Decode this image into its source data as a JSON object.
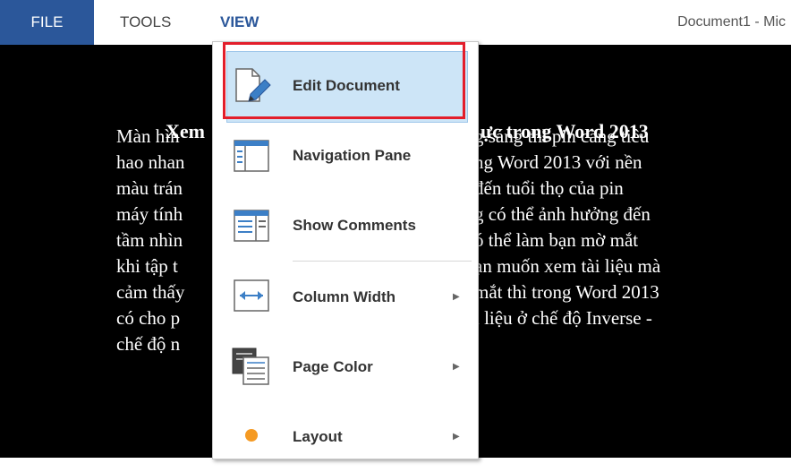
{
  "ribbon": {
    "tabs": [
      {
        "label": "FILE"
      },
      {
        "label": "TOOLS"
      },
      {
        "label": "VIEW"
      }
    ],
    "window_title": "Document1 - Mic"
  },
  "document": {
    "heading_left": "Xem",
    "heading_right": "ực trong Word 2013",
    "lines": [
      {
        "left": "Màn hìn",
        "right": "g sáng thì pin càng tiêu"
      },
      {
        "left": "hao nhan",
        "right": "ng Word 2013 với nền"
      },
      {
        "left": "màu trán",
        "right": "đến tuổi thọ của pin"
      },
      {
        "left": "máy tính",
        "right": "g có thể ảnh hưởng đến"
      },
      {
        "left": "tầm nhìn",
        "right": "ó thể làm bạn mờ mắt"
      },
      {
        "left": "khi tập t",
        "right": "ạn muốn xem tài liệu mà"
      },
      {
        "left": "cảm thấy",
        "right": "mắt thì trong Word 2013"
      },
      {
        "left": "có cho p",
        "right": "i liệu ở chế độ Inverse -"
      },
      {
        "left": "chế độ n",
        "right": ""
      }
    ]
  },
  "menu": {
    "items": [
      {
        "label": "Edit Document",
        "icon": "edit-document-icon",
        "has_submenu": false,
        "highlighted": true
      },
      {
        "label": "Navigation Pane",
        "icon": "navigation-pane-icon",
        "has_submenu": false
      },
      {
        "label": "Show Comments",
        "icon": "show-comments-icon",
        "has_submenu": false
      },
      {
        "label": "Column Width",
        "icon": "column-width-icon",
        "has_submenu": true
      },
      {
        "label": "Page Color",
        "icon": "page-color-icon",
        "has_submenu": true
      },
      {
        "label": "Layout",
        "icon": "layout-icon",
        "has_submenu": true
      }
    ],
    "submenu_arrow": "▶"
  },
  "colors": {
    "accent": "#2b579a",
    "highlight": "#cde5f7",
    "callout_frame": "#e31e2b",
    "layout_dot": "#f59a23"
  }
}
